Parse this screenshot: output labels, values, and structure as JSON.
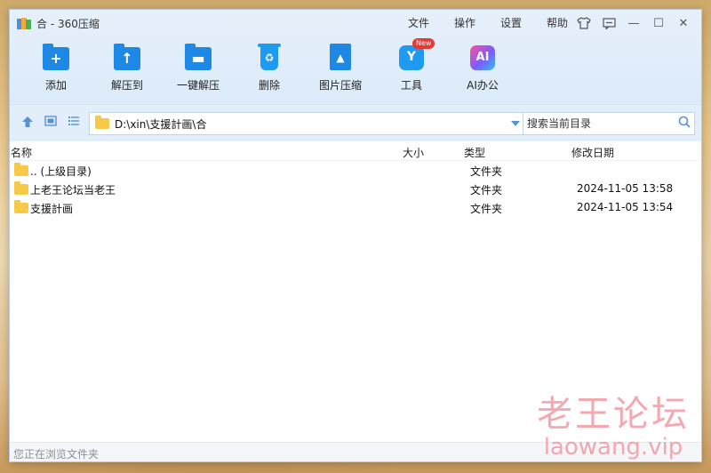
{
  "window": {
    "title": "合 - 360压缩"
  },
  "menu": {
    "items": [
      "文件",
      "操作",
      "设置",
      "帮助"
    ]
  },
  "window_controls": {
    "skin": "shirt-icon",
    "feedback": "message-icon",
    "minimize": "—",
    "maximize": "☐",
    "close": "✕"
  },
  "toolbar": {
    "items": [
      {
        "label": "添加",
        "icon": "add-folder-icon"
      },
      {
        "label": "解压到",
        "icon": "extract-to-icon"
      },
      {
        "label": "一键解压",
        "icon": "one-click-extract-icon"
      },
      {
        "label": "删除",
        "icon": "trash-icon"
      },
      {
        "label": "图片压缩",
        "icon": "image-compress-icon"
      },
      {
        "label": "工具",
        "icon": "tools-icon",
        "badge": "New"
      },
      {
        "label": "AI办公",
        "icon": "ai-office-icon",
        "glyph": "AI"
      }
    ]
  },
  "address": {
    "path": "D:\\xin\\支援計画\\合"
  },
  "search": {
    "placeholder": "搜索当前目录"
  },
  "columns": {
    "name": "名称",
    "size": "大小",
    "type": "类型",
    "date": "修改日期"
  },
  "files": [
    {
      "name": ".. (上级目录)",
      "size": "",
      "type": "文件夹",
      "date": ""
    },
    {
      "name": "上老王论坛当老王",
      "size": "",
      "type": "文件夹",
      "date": "2024-11-05 13:58"
    },
    {
      "name": "支援計画",
      "size": "",
      "type": "文件夹",
      "date": "2024-11-05 13:54"
    }
  ],
  "status": {
    "text": "您正在浏览文件夹"
  },
  "watermark": {
    "cn": "老王论坛",
    "en": "laowang.vip"
  },
  "colors": {
    "accent": "#1e88e5",
    "folder": "#f7c948",
    "watermark": "#f08c96"
  }
}
